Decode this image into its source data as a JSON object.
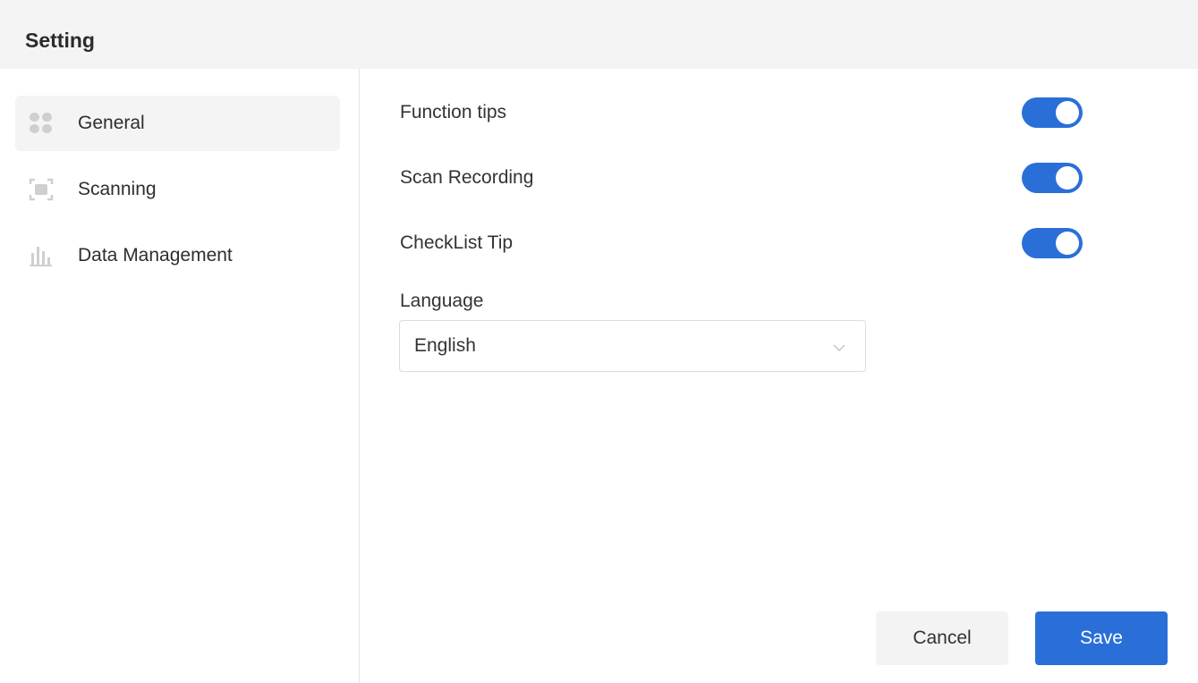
{
  "header": {
    "title": "Setting"
  },
  "sidebar": {
    "items": [
      {
        "label": "General",
        "icon": "grid-icon",
        "active": true
      },
      {
        "label": "Scanning",
        "icon": "scan-frame-icon",
        "active": false
      },
      {
        "label": "Data Management",
        "icon": "bar-chart-icon",
        "active": false
      }
    ]
  },
  "main": {
    "toggles": [
      {
        "label": "Function tips",
        "on": true
      },
      {
        "label": "Scan Recording",
        "on": true
      },
      {
        "label": "CheckList Tip",
        "on": true
      }
    ],
    "language": {
      "label": "Language",
      "value": "English"
    }
  },
  "footer": {
    "cancel_label": "Cancel",
    "save_label": "Save"
  },
  "colors": {
    "accent": "#2a6fd8",
    "header_bg": "#f4f4f4",
    "active_item_bg": "#f4f4f4"
  }
}
